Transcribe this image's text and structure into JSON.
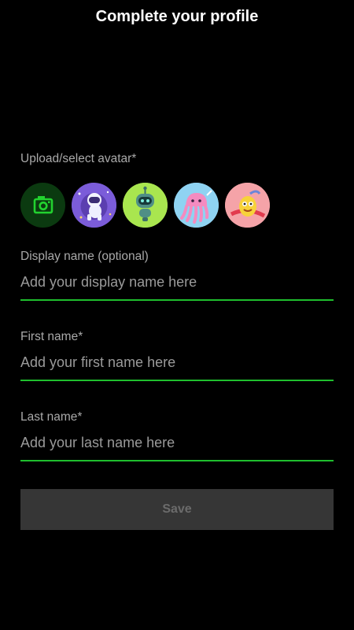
{
  "page": {
    "title": "Complete your profile"
  },
  "avatar_section": {
    "label": "Upload/select avatar*",
    "options": [
      {
        "icon": "camera-icon"
      },
      {
        "icon": "astronaut-avatar"
      },
      {
        "icon": "robot-avatar"
      },
      {
        "icon": "jellyfish-avatar"
      },
      {
        "icon": "cartoon-creature-avatar"
      }
    ]
  },
  "fields": {
    "display_name": {
      "label": "Display name (optional)",
      "placeholder": "Add your display name here",
      "value": ""
    },
    "first_name": {
      "label": "First name*",
      "placeholder": "Add your first name here",
      "value": ""
    },
    "last_name": {
      "label": "Last name*",
      "placeholder": "Add your last name here",
      "value": ""
    }
  },
  "save_button": {
    "label": "Save"
  },
  "colors": {
    "accent": "#1fbf2e",
    "background": "#000000",
    "disabled_button": "#363636"
  }
}
